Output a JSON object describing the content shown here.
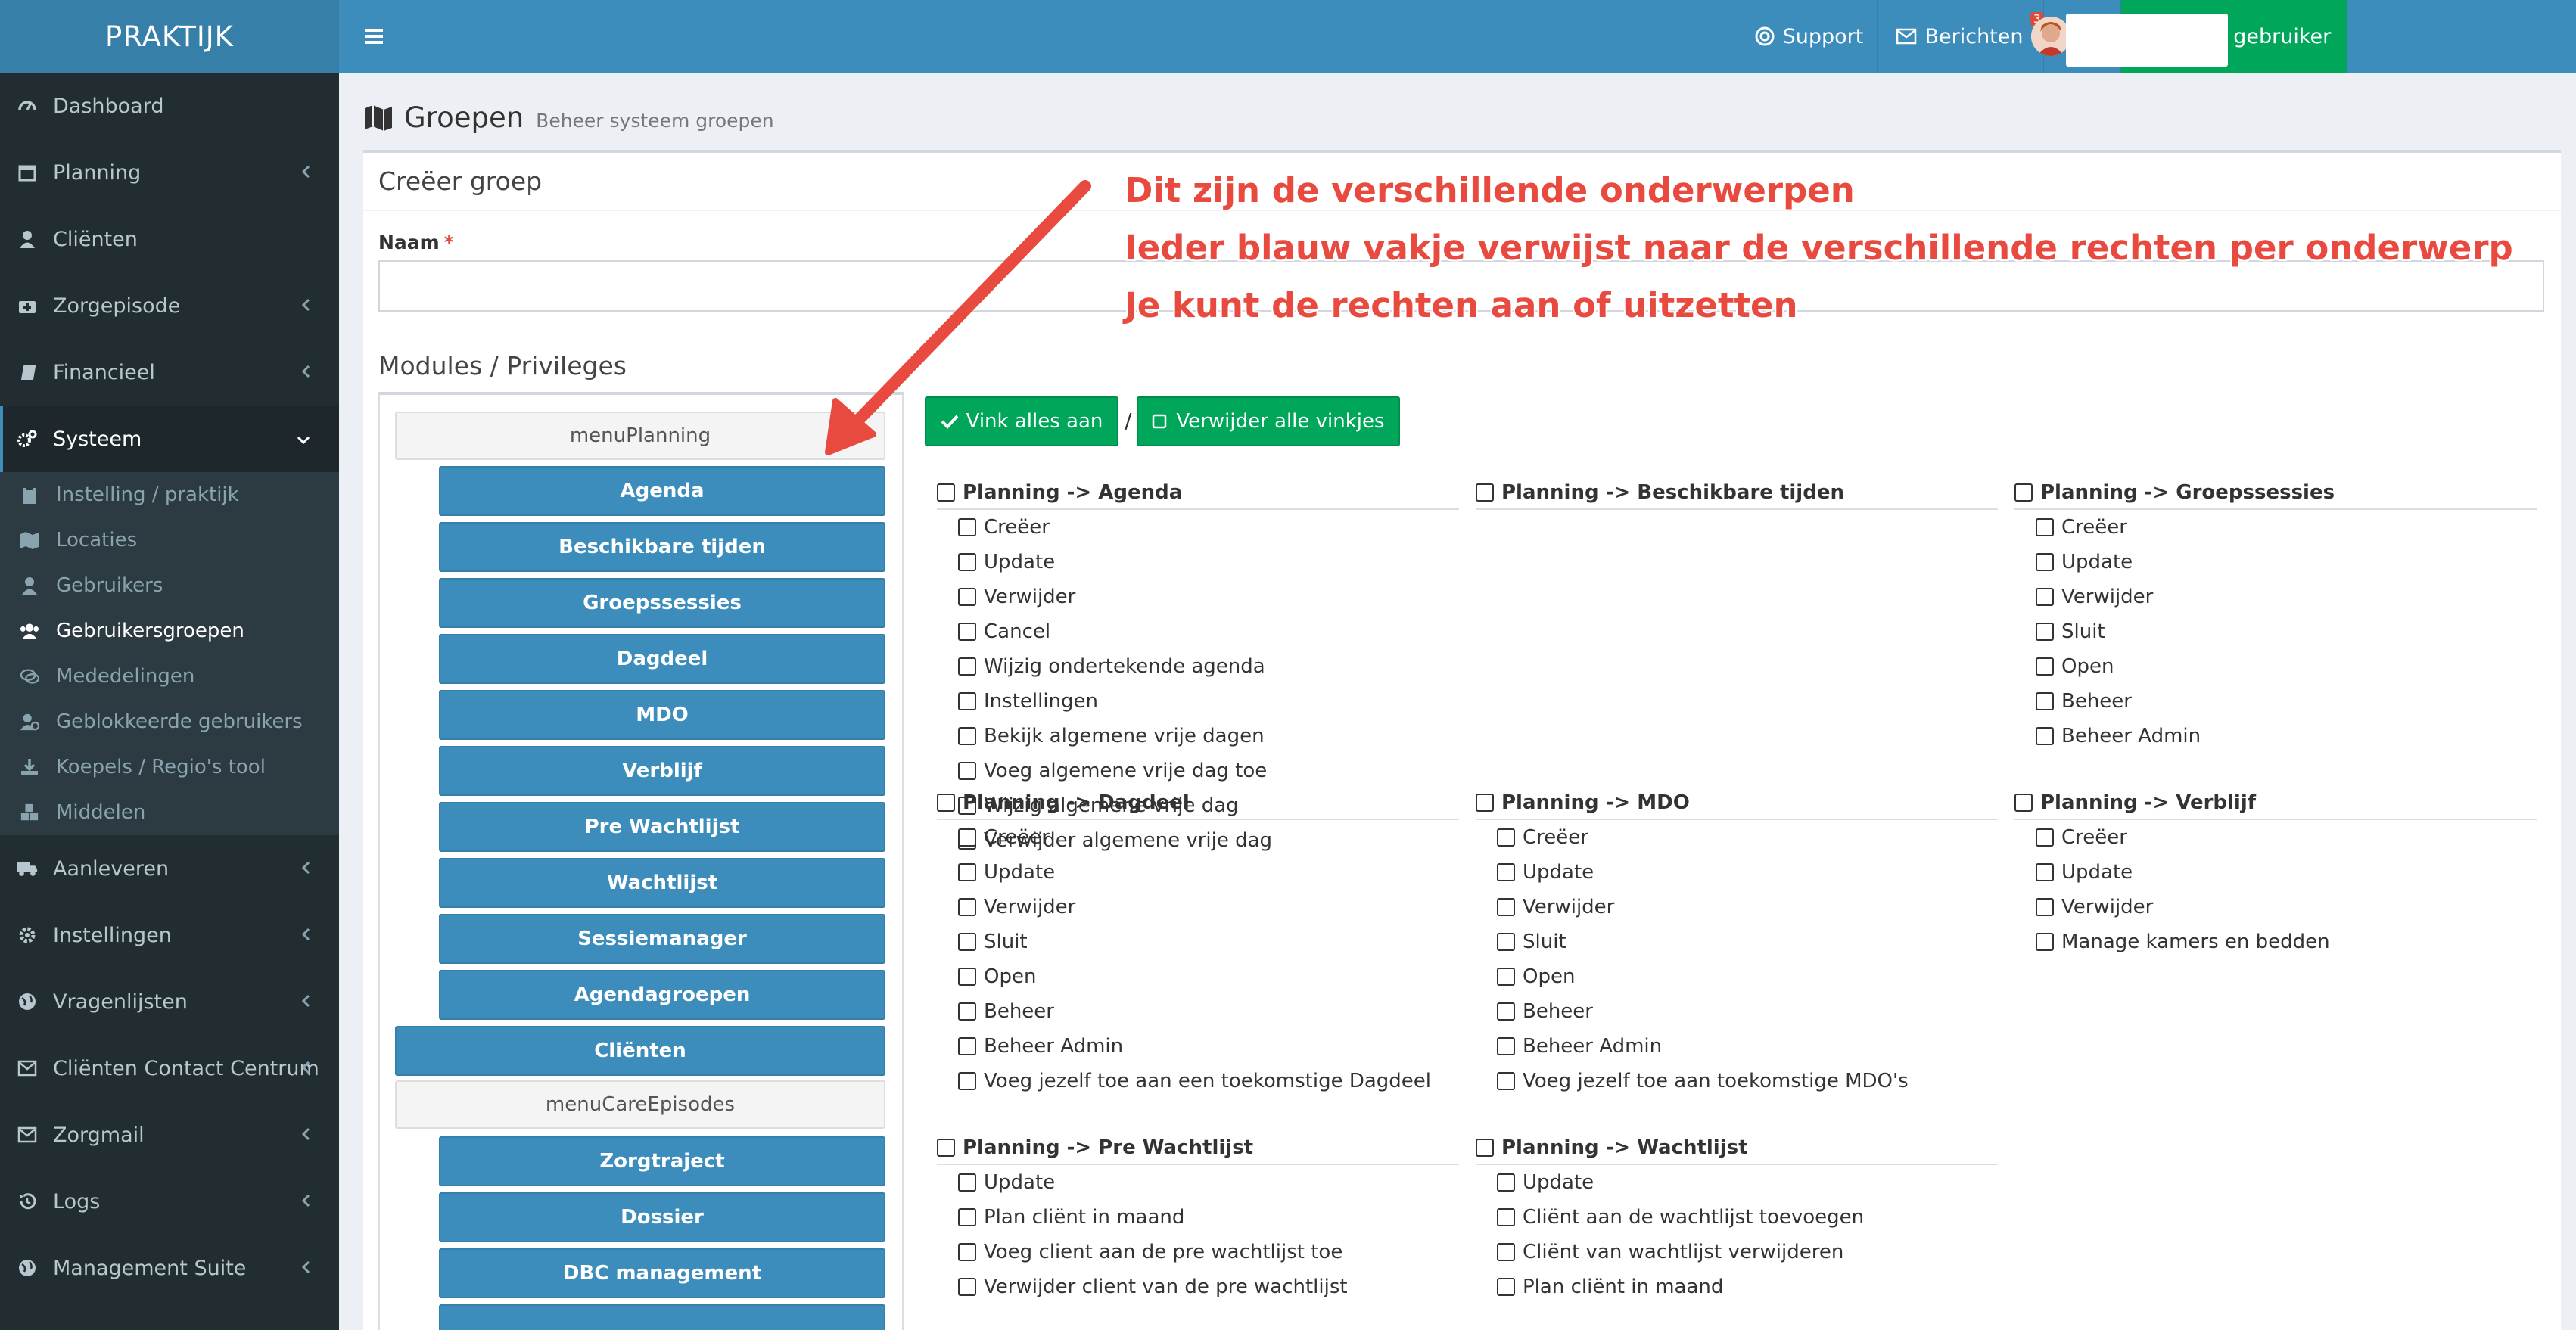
{
  "brand": "PRAKTIJK",
  "sidebar": {
    "items": [
      {
        "label": "Dashboard",
        "icon": "dashboard-icon"
      },
      {
        "label": "Planning",
        "icon": "calendar-icon",
        "chevron": true
      },
      {
        "label": "Cliënten",
        "icon": "user-icon"
      },
      {
        "label": "Zorgepisode",
        "icon": "medkit-icon",
        "chevron": true
      },
      {
        "label": "Financieel",
        "icon": "book-icon",
        "chevron": true
      },
      {
        "label": "Systeem",
        "icon": "cogs-icon",
        "chevron": true,
        "active": true
      }
    ],
    "sub_items": [
      {
        "label": "Instelling / praktijk",
        "icon": "clipboard-icon"
      },
      {
        "label": "Locaties",
        "icon": "map-icon"
      },
      {
        "label": "Gebruikers",
        "icon": "user-icon"
      },
      {
        "label": "Gebruikersgroepen",
        "icon": "users-icon",
        "active": true
      },
      {
        "label": "Mededelingen",
        "icon": "comments-icon"
      },
      {
        "label": "Geblokkeerde gebruikers",
        "icon": "user-block-icon"
      },
      {
        "label": "Koepels / Regio's tool",
        "icon": "download-icon"
      },
      {
        "label": "Middelen",
        "icon": "cubes-icon"
      }
    ],
    "items_after": [
      {
        "label": "Aanleveren",
        "icon": "truck-icon",
        "chevron": true
      },
      {
        "label": "Instellingen",
        "icon": "gear-icon",
        "chevron": true
      },
      {
        "label": "Vragenlijsten",
        "icon": "globe-icon",
        "chevron": true
      },
      {
        "label": "Cliënten Contact Centrum",
        "icon": "envelope-icon",
        "chevron": true
      },
      {
        "label": "Zorgmail",
        "icon": "envelope-icon",
        "chevron": true
      },
      {
        "label": "Logs",
        "icon": "history-icon",
        "chevron": true
      },
      {
        "label": "Management Suite",
        "icon": "globe-icon",
        "chevron": true
      }
    ]
  },
  "topbar": {
    "support": "Support",
    "berichten": "Berichten",
    "berichten_badge": "3",
    "wissel": "Wissel gebruiker"
  },
  "header": {
    "title": "Groepen",
    "subtitle": "Beheer systeem groepen"
  },
  "form": {
    "box_title": "Creëer groep",
    "naam_label": "Naam",
    "required_mark": "*",
    "naam_value": "",
    "modules_label": "Modules / Privileges"
  },
  "menu": {
    "head1": "menuPlanning",
    "planning_items": [
      "Agenda",
      "Beschikbare tijden",
      "Groepssessies",
      "Dagdeel",
      "MDO",
      "Verblijf",
      "Pre Wachtlijst",
      "Wachtlijst",
      "Sessiemanager",
      "Agendagroepen"
    ],
    "clienten": "Cliënten",
    "head2": "menuCareEpisodes",
    "care_items": [
      "Zorgtraject",
      "Dossier",
      "DBC management"
    ]
  },
  "actions": {
    "check_all": "Vink alles aan",
    "separator": "/",
    "uncheck_all": "Verwijder alle vinkjes"
  },
  "columns": [
    {
      "title": "Planning -> Agenda",
      "perms": [
        "Creëer",
        "Update",
        "Verwijder",
        "Cancel",
        "Wijzig ondertekende agenda",
        "Instellingen",
        "Bekijk algemene vrije dagen",
        "Voeg algemene vrije dag toe",
        "Wijzig algemene vrije dag",
        "Verwijder algemene vrije dag"
      ]
    },
    {
      "title": "Planning -> Beschikbare tijden",
      "perms": []
    },
    {
      "title": "Planning -> Groepssessies",
      "perms": [
        "Creëer",
        "Update",
        "Verwijder",
        "Sluit",
        "Open",
        "Beheer",
        "Beheer Admin"
      ]
    },
    {
      "title": "Planning -> Dagdeel",
      "perms": [
        "Creëer",
        "Update",
        "Verwijder",
        "Sluit",
        "Open",
        "Beheer",
        "Beheer Admin",
        "Voeg jezelf toe aan een toekomstige Dagdeel"
      ]
    },
    {
      "title": "Planning -> MDO",
      "perms": [
        "Creëer",
        "Update",
        "Verwijder",
        "Sluit",
        "Open",
        "Beheer",
        "Beheer Admin",
        "Voeg jezelf toe aan toekomstige MDO's"
      ]
    },
    {
      "title": "Planning -> Verblijf",
      "perms": [
        "Creëer",
        "Update",
        "Verwijder",
        "Manage kamers en bedden"
      ]
    },
    {
      "title": "Planning -> Pre Wachtlijst",
      "perms": [
        "Update",
        "Plan cliënt in maand",
        "Voeg client aan de pre wachtlijst toe",
        "Verwijder client van de pre wachtlijst"
      ]
    },
    {
      "title": "Planning -> Wachtlijst",
      "perms": [
        "Update",
        "Cliënt aan de wachtlijst toevoegen",
        "Cliënt van wachtlijst verwijderen",
        "Plan cliënt in maand"
      ]
    }
  ],
  "annotation": {
    "line1": "Dit zijn de verschillende onderwerpen",
    "line2": " Ieder blauw vakje verwijst naar de verschillende rechten per onderwerp",
    "line3": "Je kunt de rechten aan of uitzetten",
    "color": "#e84a3f"
  },
  "colors": {
    "sidebar": "#222d32",
    "topbar": "#3c8dbc",
    "primary": "#3c8dbc",
    "success": "#00a65a"
  }
}
